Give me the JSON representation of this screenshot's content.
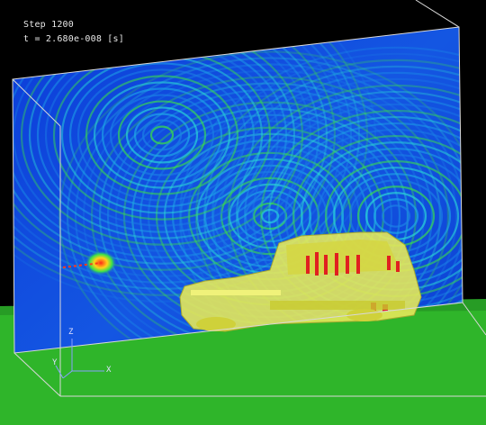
{
  "hud": {
    "step_label": "Step 1200",
    "time_label": "t = 2.680e-008 [s]"
  },
  "axes": {
    "x_label": "X",
    "y_label": "Y",
    "z_label": "Z"
  },
  "colors": {
    "background": "#000000",
    "field_low": "#0a2fd8",
    "field_mid": "#26c7e0",
    "field_high": "#33e84a",
    "field_peak": "#e02020",
    "ground": "#2fb52a",
    "car_body": "#e6e85a",
    "box_edge": "#d8d8d8"
  },
  "icons": {
    "axis_triad": "xyz-axis-icon"
  }
}
